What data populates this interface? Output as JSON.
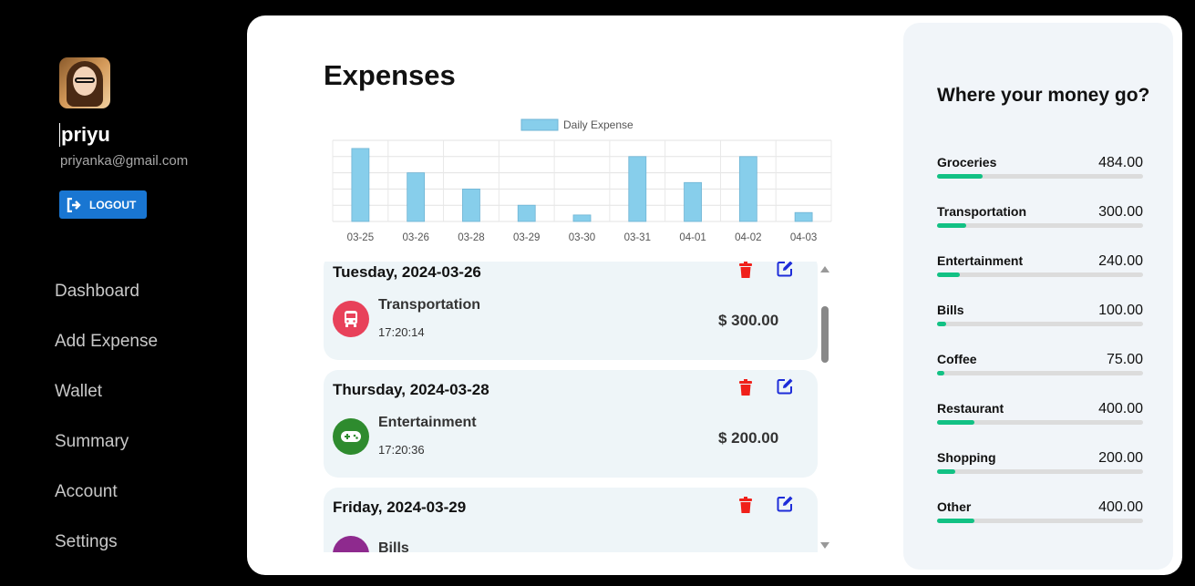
{
  "sidebar": {
    "username": "priyu",
    "email": "priyanka@gmail.com",
    "logout_label": "LOGOUT",
    "nav": [
      "Dashboard",
      "Add Expense",
      "Wallet",
      "Summary",
      "Account",
      "Settings"
    ]
  },
  "main": {
    "title": "Expenses"
  },
  "chart_data": {
    "type": "bar",
    "legend": "Daily Expense",
    "legend_position": "top",
    "categories": [
      "03-25",
      "03-26",
      "03-28",
      "03-29",
      "03-30",
      "03-31",
      "04-01",
      "04-02",
      "04-03"
    ],
    "values": [
      450,
      300,
      200,
      100,
      40,
      400,
      240,
      400,
      55
    ],
    "ylim": [
      0,
      500
    ],
    "grid": true,
    "color": "#87ceeb"
  },
  "expenses": [
    {
      "date": "Tuesday, 2024-03-26",
      "category": "Transportation",
      "time": "17:20:14",
      "amount": "$ 300.00",
      "icon": "bus-icon",
      "color": "#e8415a"
    },
    {
      "date": "Thursday, 2024-03-28",
      "category": "Entertainment",
      "time": "17:20:36",
      "amount": "$ 200.00",
      "icon": "gamepad-icon",
      "color": "#2e8b2e"
    },
    {
      "date": "Friday, 2024-03-29",
      "category": "Bills",
      "time": "",
      "amount": "",
      "icon": "bills-icon",
      "color": "#8e2a8e"
    }
  ],
  "summary": {
    "title": "Where your money go?",
    "items": [
      {
        "name": "Groceries",
        "value": "484.00",
        "fraction": 0.22
      },
      {
        "name": "Transportation",
        "value": "300.00",
        "fraction": 0.14
      },
      {
        "name": "Entertainment",
        "value": "240.00",
        "fraction": 0.11
      },
      {
        "name": "Bills",
        "value": "100.00",
        "fraction": 0.045
      },
      {
        "name": "Coffee",
        "value": "75.00",
        "fraction": 0.034
      },
      {
        "name": "Restaurant",
        "value": "400.00",
        "fraction": 0.18
      },
      {
        "name": "Shopping",
        "value": "200.00",
        "fraction": 0.09
      },
      {
        "name": "Other",
        "value": "400.00",
        "fraction": 0.18
      }
    ]
  }
}
